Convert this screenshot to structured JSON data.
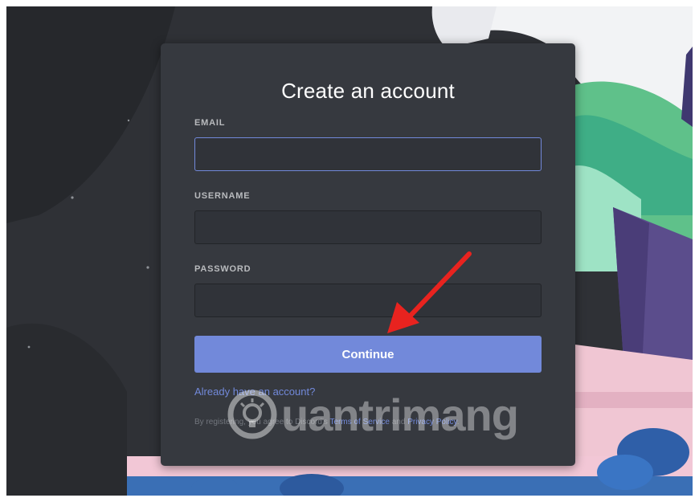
{
  "dialog": {
    "title": "Create an account",
    "email_label": "EMAIL",
    "email_value": "",
    "username_label": "USERNAME",
    "username_value": "",
    "password_label": "PASSWORD",
    "password_value": "",
    "continue_label": "Continue",
    "login_link": "Already have an account?",
    "terms_prefix": "By registering, you agree to Discord's ",
    "terms_of_service": "Terms of Service",
    "terms_middle": " and ",
    "privacy_policy": "Privacy Policy",
    "terms_suffix": "."
  },
  "watermark": {
    "text": "uantrimang"
  },
  "colors": {
    "card_bg": "#36393f",
    "input_bg": "#303339",
    "accent": "#7289da",
    "label": "#b9bbbe",
    "arrow": "#e8231f"
  },
  "icons": {
    "watermark_logo": "lightbulb-gear-icon",
    "annotation": "red-arrow-icon"
  }
}
